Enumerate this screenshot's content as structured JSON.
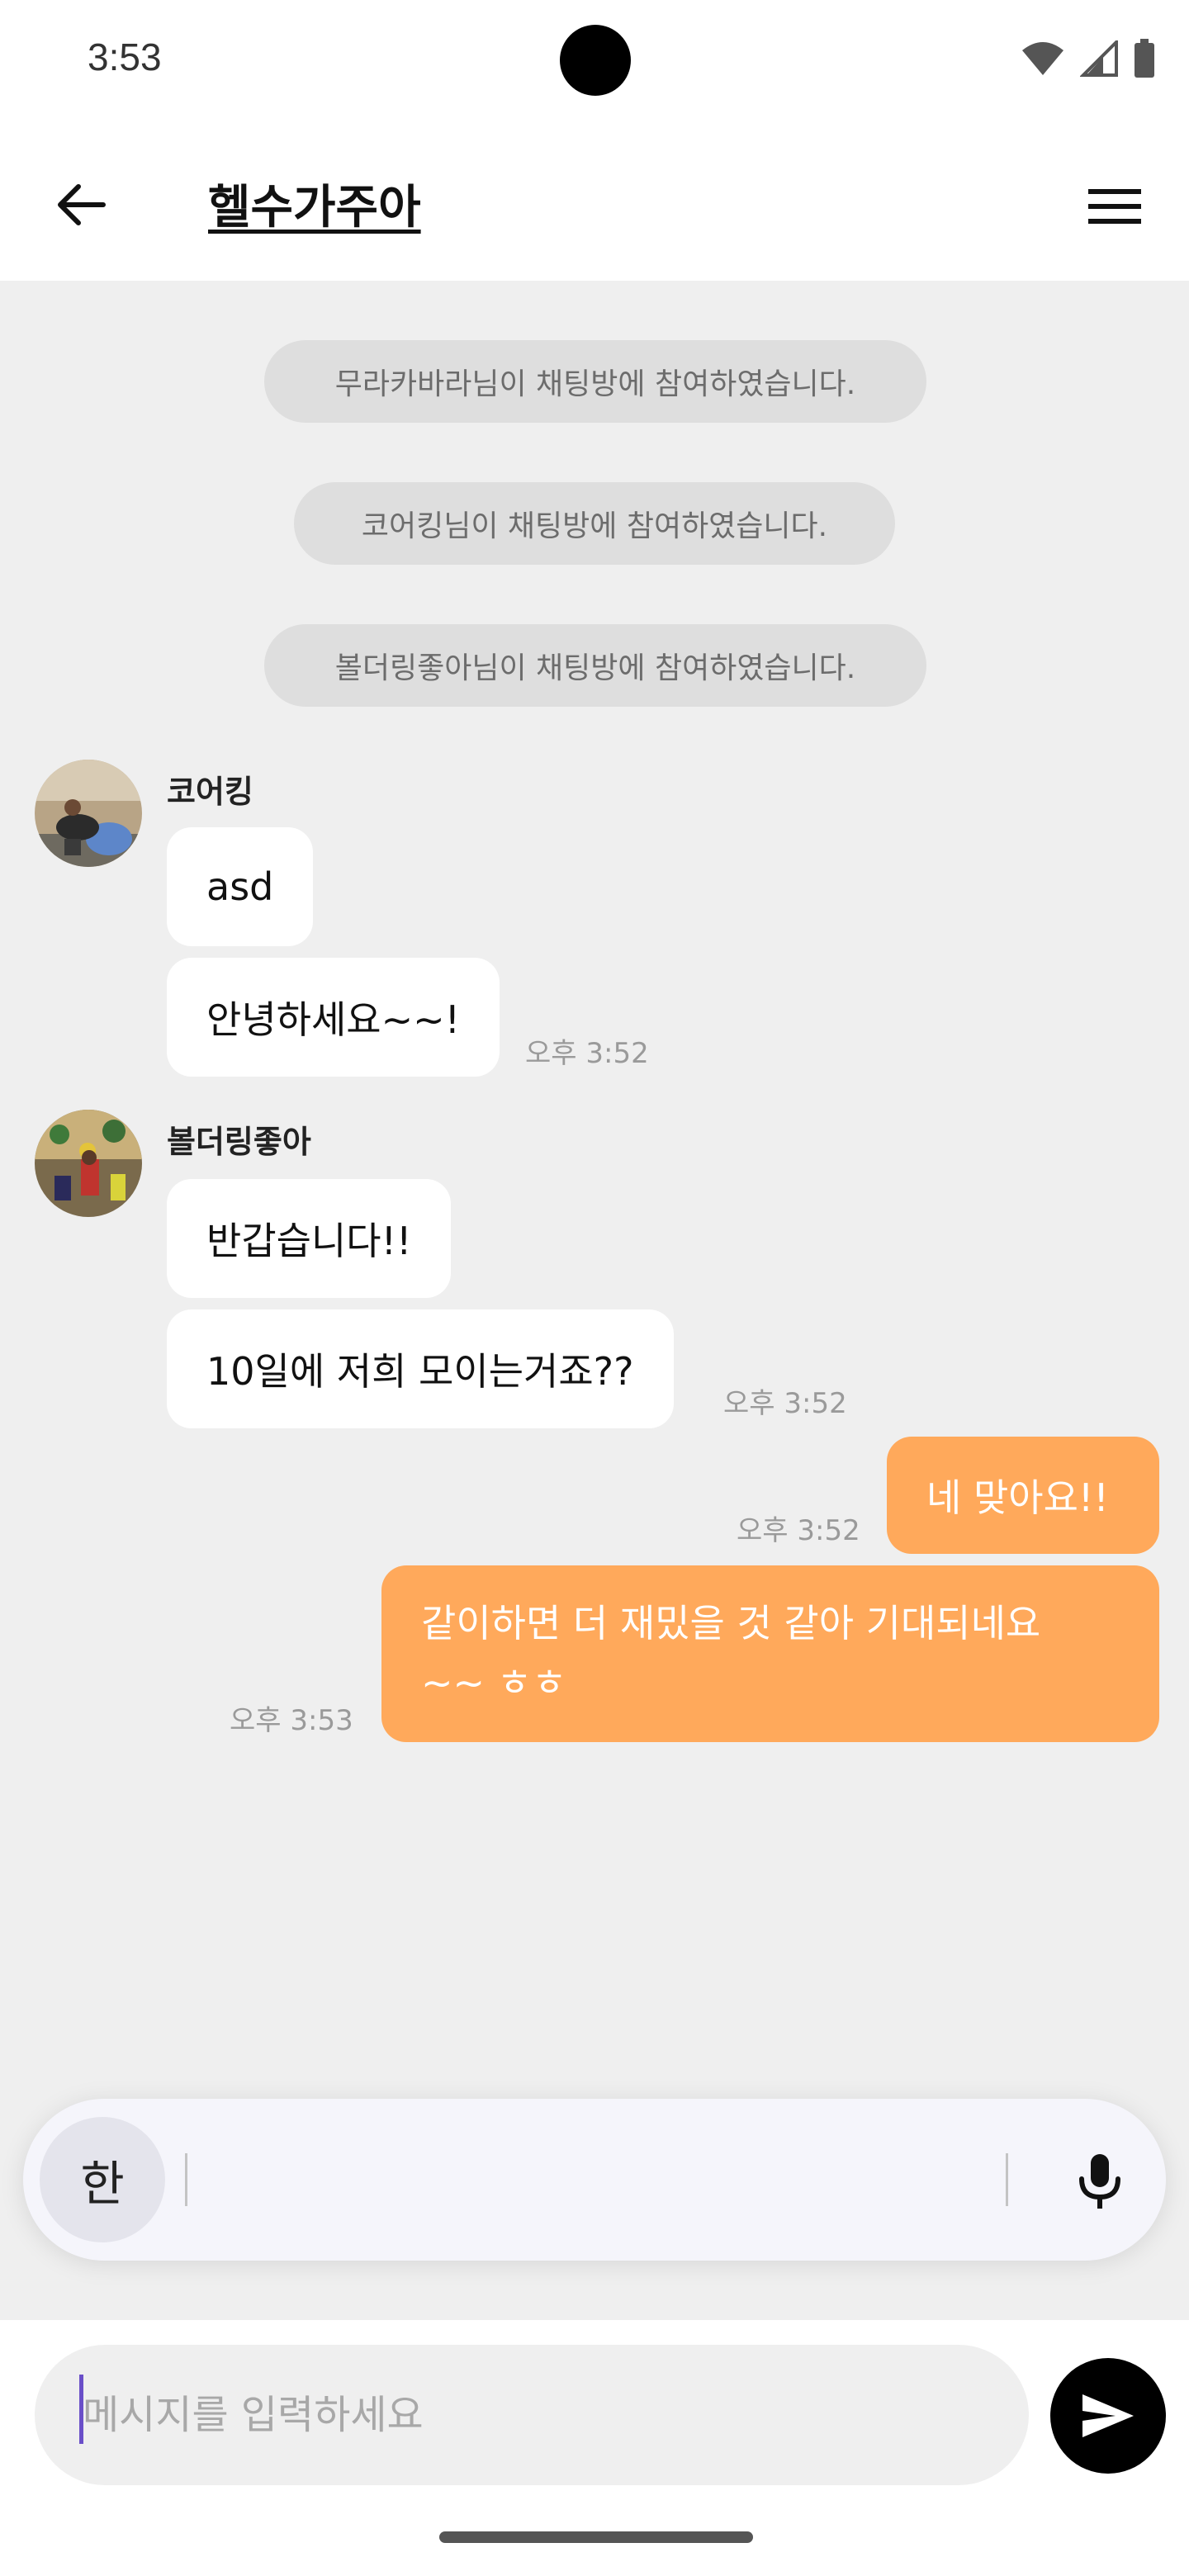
{
  "status_bar": {
    "time": "3:53"
  },
  "header": {
    "title": "헬수가주아",
    "back_icon": "arrow-left-icon",
    "menu_icon": "hamburger-menu-icon"
  },
  "system_messages": [
    "무라카바라님이 채팅방에 참여하였습니다.",
    "코어킹님이 채팅방에 참여하였습니다.",
    "볼더링좋아님이 채팅방에 참여하였습니다."
  ],
  "groups": [
    {
      "sender": "코어킹",
      "messages": [
        "asd",
        "안녕하세요~~!"
      ],
      "time": "오후 3:52"
    },
    {
      "sender": "볼더링좋아",
      "messages": [
        "반갑습니다!!",
        "10일에 저희 모이는거죠??"
      ],
      "time": "오후 3:52"
    }
  ],
  "my_messages": [
    {
      "lines": [
        "네 맞아요!!"
      ],
      "time": "오후 3:52"
    },
    {
      "lines": [
        "같이하면 더 재밌을 것 같아 기대되네요",
        "~~ ㅎㅎ"
      ],
      "time": "오후 3:53"
    }
  ],
  "keyboard": {
    "lang_key": "한",
    "mic_icon": "microphone-icon"
  },
  "composer": {
    "placeholder": "메시지를 입력하세요",
    "send_icon": "send-icon"
  },
  "colors": {
    "accent_bubble": "#ffa95b",
    "background": "#efefef"
  }
}
